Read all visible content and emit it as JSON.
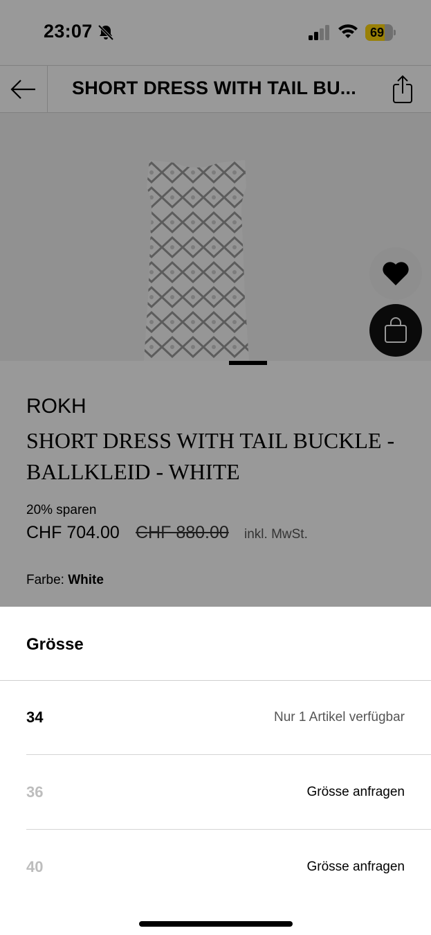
{
  "status_bar": {
    "time": "23:07",
    "battery": "69",
    "battery_level": 0.69
  },
  "header": {
    "title": "SHORT DRESS WITH TAIL BU..."
  },
  "product": {
    "brand": "ROKH",
    "name": "SHORT DRESS WITH TAIL BUCKLE - BALLKLEID - WHITE",
    "discount": "20% sparen",
    "price": "CHF 704.00",
    "old_price": "CHF 880.00",
    "tax_note": "inkl. MwSt.",
    "color_label": "Farbe:",
    "color_value": "White"
  },
  "size_sheet": {
    "title": "Grösse",
    "sizes": [
      {
        "size": "34",
        "availability": "Nur 1 Artikel verfügbar",
        "available": true
      },
      {
        "size": "36",
        "availability": "Grösse anfragen",
        "available": false
      },
      {
        "size": "40",
        "availability": "Grösse anfragen",
        "available": false
      }
    ]
  },
  "icons": {
    "back": "back-arrow-icon",
    "share": "share-icon",
    "wishlist": "heart-icon",
    "cart": "shopping-bag-icon",
    "mute": "bell-slash-icon"
  },
  "colors": {
    "accent_battery": "#ffd60a",
    "bag_button": "#111111",
    "availability_muted": "#555555"
  }
}
